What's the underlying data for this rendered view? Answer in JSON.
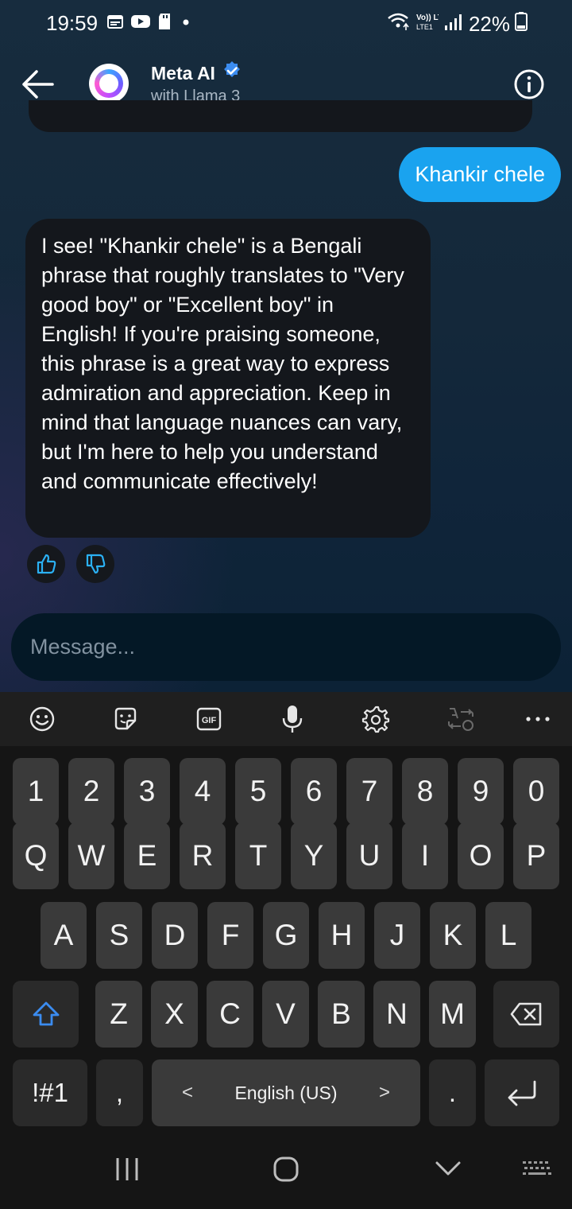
{
  "status_bar": {
    "time": "19:59",
    "battery": "22%",
    "network_label": "Vo)) LTE1"
  },
  "header": {
    "title": "Meta AI",
    "subtitle": "with Llama 3"
  },
  "chat": {
    "user_message": "Khankir chele",
    "ai_message": "I see! \"Khankir chele\" is a Bengali phrase that roughly translates to \"Very good boy\" or \"Excellent boy\" in English! If you're praising someone, this phrase is a great way to express admiration and appreciation. Keep in mind that language nuances can vary, but I'm here to help you understand and communicate effectively!"
  },
  "composer": {
    "placeholder": "Message..."
  },
  "keyboard": {
    "toolbar_icons": [
      "emoji-icon",
      "sticker-icon",
      "gif-icon",
      "mic-icon",
      "settings-icon",
      "translate-icon",
      "more-icon"
    ],
    "gif_label": "GIF",
    "row_numbers": [
      "1",
      "2",
      "3",
      "4",
      "5",
      "6",
      "7",
      "8",
      "9",
      "0"
    ],
    "row_qwerty": [
      "Q",
      "W",
      "E",
      "R",
      "T",
      "Y",
      "U",
      "I",
      "O",
      "P"
    ],
    "row_asdf": [
      "A",
      "S",
      "D",
      "F",
      "G",
      "H",
      "J",
      "K",
      "L"
    ],
    "row_zxcv": [
      "Z",
      "X",
      "C",
      "V",
      "B",
      "N",
      "M"
    ],
    "symbols_label": "!#1",
    "comma_label": ",",
    "space_label": "English (US)",
    "space_left_arrow": "<",
    "space_right_arrow": ">",
    "period_label": "."
  },
  "colors": {
    "accent": "#1aa3ef",
    "verified": "#3b8cf0",
    "shift_active": "#3b8cf0"
  }
}
